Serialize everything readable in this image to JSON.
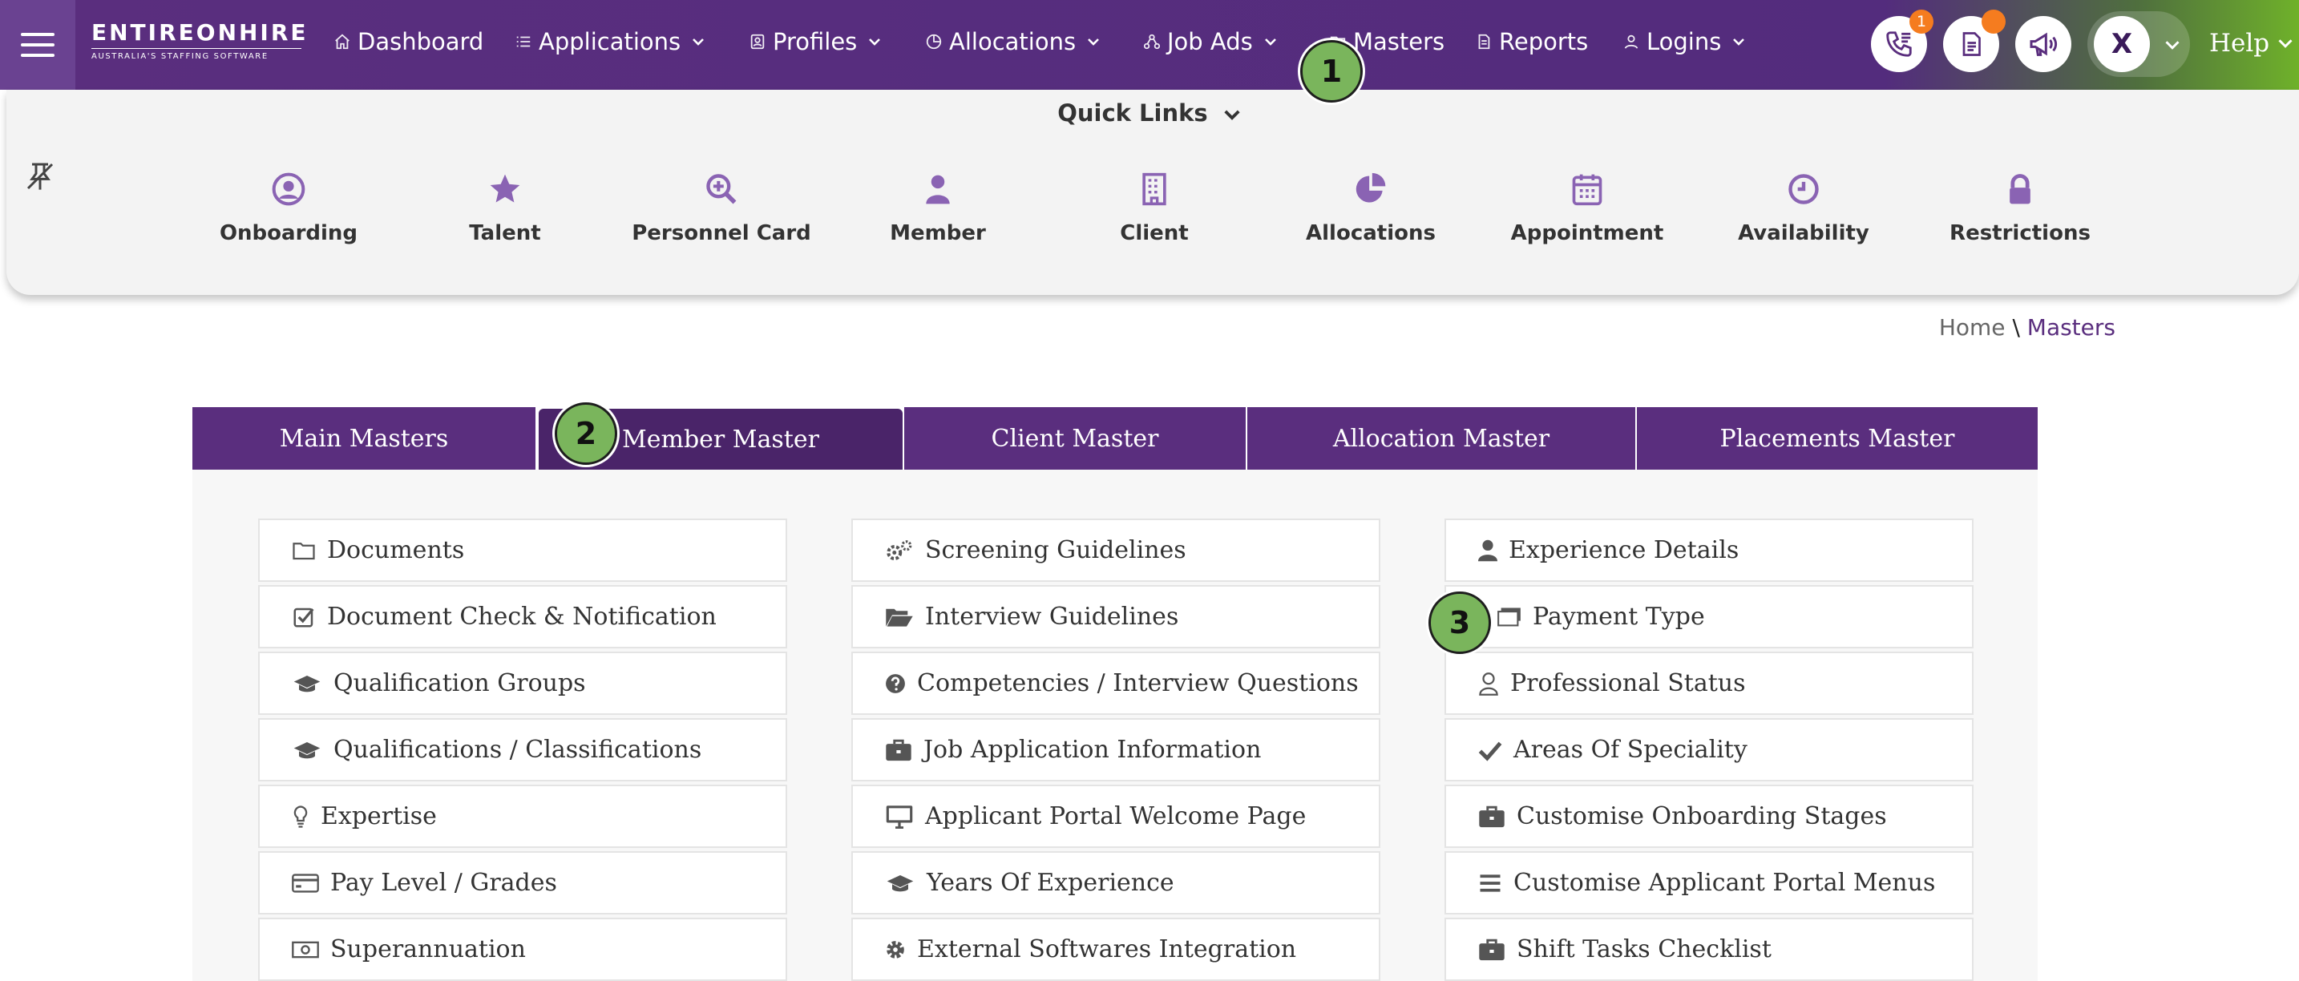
{
  "brand": {
    "name": "ENTIREONHIRE",
    "tagline": "AUSTRALIA'S STAFFING SOFTWARE"
  },
  "nav": [
    {
      "label": "Dashboard",
      "icon": "home-icon",
      "dropdown": false
    },
    {
      "label": "Applications",
      "icon": "list-icon",
      "dropdown": true
    },
    {
      "label": "Profiles",
      "icon": "profile-card-icon",
      "dropdown": true
    },
    {
      "label": "Allocations",
      "icon": "pie-icon",
      "dropdown": true
    },
    {
      "label": "Job Ads",
      "icon": "network-icon",
      "dropdown": true
    },
    {
      "label": "Masters",
      "icon": "folder-icon",
      "dropdown": false
    },
    {
      "label": "Reports",
      "icon": "report-icon",
      "dropdown": false
    },
    {
      "label": "Logins",
      "icon": "user-icon",
      "dropdown": true
    }
  ],
  "header_actions": {
    "calls_badge": "1",
    "user_initial": "X",
    "help_label": "Help"
  },
  "quick_links": {
    "title": "Quick Links",
    "items": [
      {
        "label": "Onboarding",
        "icon": "user-circle-icon"
      },
      {
        "label": "Talent",
        "icon": "star-icon"
      },
      {
        "label": "Personnel Card",
        "icon": "search-plus-icon"
      },
      {
        "label": "Member",
        "icon": "person-icon"
      },
      {
        "label": "Client",
        "icon": "building-icon"
      },
      {
        "label": "Allocations",
        "icon": "pie-chart-icon"
      },
      {
        "label": "Appointment",
        "icon": "calendar-icon"
      },
      {
        "label": "Availability",
        "icon": "clock-icon"
      },
      {
        "label": "Restrictions",
        "icon": "lock-icon"
      }
    ]
  },
  "breadcrumb": {
    "home": "Home",
    "separator": "\\",
    "current": "Masters"
  },
  "tabs": [
    {
      "label": "Main Masters",
      "active": false
    },
    {
      "label": "Member Master",
      "active": true
    },
    {
      "label": "Client Master",
      "active": false
    },
    {
      "label": "Allocation Master",
      "active": false
    },
    {
      "label": "Placements Master",
      "active": false
    }
  ],
  "columns": [
    [
      {
        "label": "Documents",
        "icon": "folder-icon"
      },
      {
        "label": "Document Check & Notification",
        "icon": "check-square-icon"
      },
      {
        "label": "Qualification Groups",
        "icon": "graduation-cap-icon"
      },
      {
        "label": "Qualifications / Classifications",
        "icon": "graduation-cap-icon"
      },
      {
        "label": "Expertise",
        "icon": "lightbulb-icon"
      },
      {
        "label": "Pay Level / Grades",
        "icon": "credit-card-icon"
      },
      {
        "label": "Superannuation",
        "icon": "money-icon"
      }
    ],
    [
      {
        "label": "Screening Guidelines",
        "icon": "gears-icon"
      },
      {
        "label": "Interview Guidelines",
        "icon": "folder-open-icon"
      },
      {
        "label": "Competencies / Interview Questions",
        "icon": "question-circle-icon"
      },
      {
        "label": "Job Application Information",
        "icon": "briefcase-icon"
      },
      {
        "label": "Applicant Portal Welcome Page",
        "icon": "monitor-icon"
      },
      {
        "label": "Years Of Experience",
        "icon": "graduation-cap-icon"
      },
      {
        "label": "External Softwares Integration",
        "icon": "gear-icon"
      }
    ],
    [
      {
        "label": "Experience Details",
        "icon": "user-icon"
      },
      {
        "label": "Payment Type",
        "icon": "money-icon"
      },
      {
        "label": "Professional Status",
        "icon": "user-outline-icon"
      },
      {
        "label": "Areas Of Speciality",
        "icon": "check-icon"
      },
      {
        "label": "Customise Onboarding Stages",
        "icon": "briefcase-icon"
      },
      {
        "label": "Customise Applicant Portal Menus",
        "icon": "bars-icon"
      },
      {
        "label": "Shift Tasks Checklist",
        "icon": "briefcase-icon"
      }
    ]
  ],
  "markers": [
    "1",
    "2",
    "3"
  ],
  "colors": {
    "brand_purple": "#5a2e7e",
    "accent_green": "#7ab55c",
    "badge_orange": "#f57c1f"
  }
}
